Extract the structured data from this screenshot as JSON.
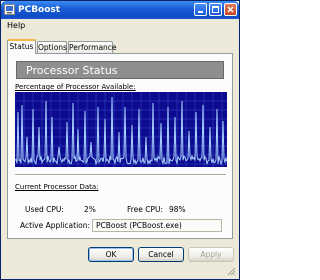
{
  "window": {
    "title": "PCBoost"
  },
  "menu": {
    "help_label": "Help"
  },
  "tabs": [
    {
      "label": "Status"
    },
    {
      "label": "Options"
    },
    {
      "label": "Performance"
    }
  ],
  "status": {
    "header_title": "Processor Status",
    "graph_label": "Percentage of Processor Available:",
    "data_label": "Current Processor Data:",
    "used_cpu_label": "Used CPU:",
    "used_cpu_value": "2%",
    "free_cpu_label": "Free CPU:",
    "free_cpu_value": "98%",
    "active_app_label": "Active Application:",
    "active_app_value": "PCBoost (PCBoost.exe)"
  },
  "buttons": {
    "ok": "OK",
    "cancel": "Cancel",
    "apply": "Apply"
  },
  "colors": {
    "graph_bg": "#0c0a8e",
    "graph_line": "#a9d2ff",
    "graph_grid": "#3a4bd0",
    "titlebar": "#0c4cc8"
  }
}
